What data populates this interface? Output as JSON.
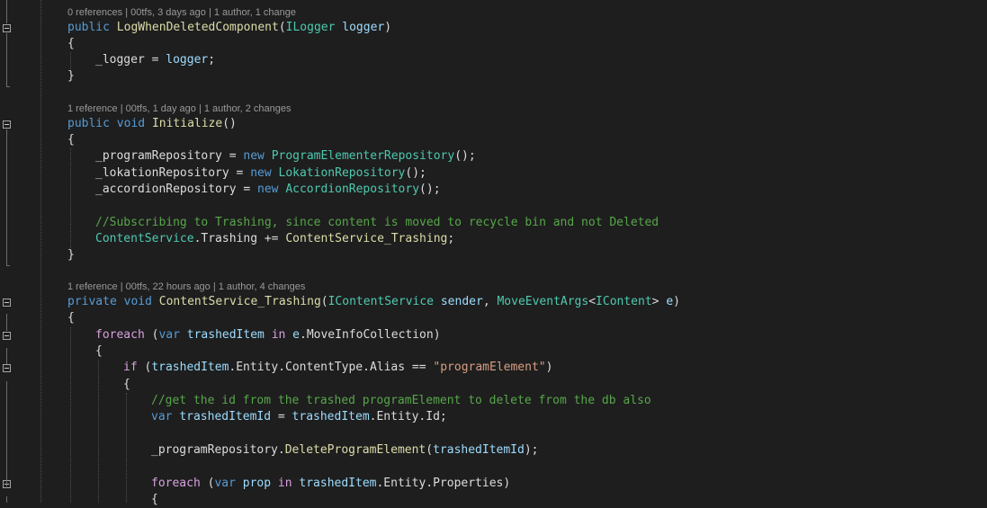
{
  "editor": {
    "theme_colors": {
      "background": "#1e1e1e",
      "keyword": "#569cd6",
      "control_keyword": "#d8a0df",
      "method": "#dcdcaa",
      "type": "#4ec9b0",
      "parameter": "#9cdcfe",
      "comment": "#57a64a",
      "string": "#d69d85",
      "plain": "#dcdcdc",
      "codelens": "#999999"
    },
    "fold_icon": "collapse-minus-icon",
    "lines": [
      {
        "kind": "lens",
        "indent": 0,
        "text": "0 references | 00tfs, 3 days ago | 1 author, 1 change"
      },
      {
        "kind": "code",
        "indent": 0,
        "fold": true,
        "tokens": [
          {
            "t": "public",
            "c": "kw"
          },
          {
            "t": " ",
            "c": "pl"
          },
          {
            "t": "LogWhenDeletedComponent",
            "c": "mth"
          },
          {
            "t": "(",
            "c": "pl"
          },
          {
            "t": "ILogger",
            "c": "typ"
          },
          {
            "t": " ",
            "c": "pl"
          },
          {
            "t": "logger",
            "c": "par"
          },
          {
            "t": ")",
            "c": "pl"
          }
        ]
      },
      {
        "kind": "code",
        "indent": 0,
        "tokens": [
          {
            "t": "{",
            "c": "pl"
          }
        ]
      },
      {
        "kind": "code",
        "indent": 1,
        "tokens": [
          {
            "t": "_logger = ",
            "c": "pl"
          },
          {
            "t": "logger",
            "c": "par"
          },
          {
            "t": ";",
            "c": "pl"
          }
        ]
      },
      {
        "kind": "code",
        "indent": 0,
        "tokens": [
          {
            "t": "}",
            "c": "pl"
          }
        ]
      },
      {
        "kind": "blank"
      },
      {
        "kind": "lens",
        "indent": 0,
        "text": "1 reference | 00tfs, 1 day ago | 1 author, 2 changes"
      },
      {
        "kind": "code",
        "indent": 0,
        "fold": true,
        "tokens": [
          {
            "t": "public",
            "c": "kw"
          },
          {
            "t": " ",
            "c": "pl"
          },
          {
            "t": "void",
            "c": "kw"
          },
          {
            "t": " ",
            "c": "pl"
          },
          {
            "t": "Initialize",
            "c": "mth"
          },
          {
            "t": "()",
            "c": "pl"
          }
        ]
      },
      {
        "kind": "code",
        "indent": 0,
        "tokens": [
          {
            "t": "{",
            "c": "pl"
          }
        ]
      },
      {
        "kind": "code",
        "indent": 1,
        "tokens": [
          {
            "t": "_programRepository = ",
            "c": "pl"
          },
          {
            "t": "new",
            "c": "kw"
          },
          {
            "t": " ",
            "c": "pl"
          },
          {
            "t": "ProgramElementerRepository",
            "c": "typ"
          },
          {
            "t": "();",
            "c": "pl"
          }
        ]
      },
      {
        "kind": "code",
        "indent": 1,
        "tokens": [
          {
            "t": "_lokationRepository = ",
            "c": "pl"
          },
          {
            "t": "new",
            "c": "kw"
          },
          {
            "t": " ",
            "c": "pl"
          },
          {
            "t": "LokationRepository",
            "c": "typ"
          },
          {
            "t": "();",
            "c": "pl"
          }
        ]
      },
      {
        "kind": "code",
        "indent": 1,
        "tokens": [
          {
            "t": "_accordionRepository = ",
            "c": "pl"
          },
          {
            "t": "new",
            "c": "kw"
          },
          {
            "t": " ",
            "c": "pl"
          },
          {
            "t": "AccordionRepository",
            "c": "typ"
          },
          {
            "t": "();",
            "c": "pl"
          }
        ]
      },
      {
        "kind": "blank"
      },
      {
        "kind": "code",
        "indent": 1,
        "tokens": [
          {
            "t": "//Subscribing to Trashing, since content is moved to recycle bin and not Deleted",
            "c": "cmt"
          }
        ]
      },
      {
        "kind": "code",
        "indent": 1,
        "tokens": [
          {
            "t": "ContentService",
            "c": "typ"
          },
          {
            "t": ".Trashing += ",
            "c": "pl"
          },
          {
            "t": "ContentService_Trashing",
            "c": "mth"
          },
          {
            "t": ";",
            "c": "pl"
          }
        ]
      },
      {
        "kind": "code",
        "indent": 0,
        "tokens": [
          {
            "t": "}",
            "c": "pl"
          }
        ]
      },
      {
        "kind": "blank"
      },
      {
        "kind": "lens",
        "indent": 0,
        "text": "1 reference | 00tfs, 22 hours ago | 1 author, 4 changes"
      },
      {
        "kind": "code",
        "indent": 0,
        "fold": true,
        "tokens": [
          {
            "t": "private",
            "c": "kw"
          },
          {
            "t": " ",
            "c": "pl"
          },
          {
            "t": "void",
            "c": "kw"
          },
          {
            "t": " ",
            "c": "pl"
          },
          {
            "t": "ContentService_Trashing",
            "c": "mth"
          },
          {
            "t": "(",
            "c": "pl"
          },
          {
            "t": "IContentService",
            "c": "typ"
          },
          {
            "t": " ",
            "c": "pl"
          },
          {
            "t": "sender",
            "c": "par"
          },
          {
            "t": ", ",
            "c": "pl"
          },
          {
            "t": "MoveEventArgs",
            "c": "typ"
          },
          {
            "t": "<",
            "c": "pl"
          },
          {
            "t": "IContent",
            "c": "typ"
          },
          {
            "t": "> ",
            "c": "pl"
          },
          {
            "t": "e",
            "c": "par"
          },
          {
            "t": ")",
            "c": "pl"
          }
        ]
      },
      {
        "kind": "code",
        "indent": 0,
        "tokens": [
          {
            "t": "{",
            "c": "pl"
          }
        ]
      },
      {
        "kind": "code",
        "indent": 1,
        "fold": true,
        "tokens": [
          {
            "t": "foreach",
            "c": "ctl"
          },
          {
            "t": " (",
            "c": "pl"
          },
          {
            "t": "var",
            "c": "kw"
          },
          {
            "t": " ",
            "c": "pl"
          },
          {
            "t": "trashedItem",
            "c": "par"
          },
          {
            "t": " ",
            "c": "pl"
          },
          {
            "t": "in",
            "c": "ctl"
          },
          {
            "t": " ",
            "c": "pl"
          },
          {
            "t": "e",
            "c": "par"
          },
          {
            "t": ".MoveInfoCollection)",
            "c": "pl"
          }
        ]
      },
      {
        "kind": "code",
        "indent": 1,
        "tokens": [
          {
            "t": "{",
            "c": "pl"
          }
        ]
      },
      {
        "kind": "code",
        "indent": 2,
        "fold": true,
        "tokens": [
          {
            "t": "if",
            "c": "ctl"
          },
          {
            "t": " (",
            "c": "pl"
          },
          {
            "t": "trashedItem",
            "c": "par"
          },
          {
            "t": ".Entity.ContentType.Alias == ",
            "c": "pl"
          },
          {
            "t": "\"programElement\"",
            "c": "str"
          },
          {
            "t": ")",
            "c": "pl"
          }
        ]
      },
      {
        "kind": "code",
        "indent": 2,
        "tokens": [
          {
            "t": "{",
            "c": "pl"
          }
        ]
      },
      {
        "kind": "code",
        "indent": 3,
        "tokens": [
          {
            "t": "//get the id from the trashed programElement to delete from the db also",
            "c": "cmt"
          }
        ]
      },
      {
        "kind": "code",
        "indent": 3,
        "tokens": [
          {
            "t": "var",
            "c": "kw"
          },
          {
            "t": " ",
            "c": "pl"
          },
          {
            "t": "trashedItemId",
            "c": "par"
          },
          {
            "t": " = ",
            "c": "pl"
          },
          {
            "t": "trashedItem",
            "c": "par"
          },
          {
            "t": ".Entity.Id;",
            "c": "pl"
          }
        ]
      },
      {
        "kind": "blank"
      },
      {
        "kind": "code",
        "indent": 3,
        "tokens": [
          {
            "t": "_programRepository.",
            "c": "pl"
          },
          {
            "t": "DeleteProgramElement",
            "c": "mth"
          },
          {
            "t": "(",
            "c": "pl"
          },
          {
            "t": "trashedItemId",
            "c": "par"
          },
          {
            "t": ");",
            "c": "pl"
          }
        ]
      },
      {
        "kind": "blank"
      },
      {
        "kind": "code",
        "indent": 3,
        "fold": true,
        "tokens": [
          {
            "t": "foreach",
            "c": "ctl"
          },
          {
            "t": " (",
            "c": "pl"
          },
          {
            "t": "var",
            "c": "kw"
          },
          {
            "t": " ",
            "c": "pl"
          },
          {
            "t": "prop",
            "c": "par"
          },
          {
            "t": " ",
            "c": "pl"
          },
          {
            "t": "in",
            "c": "ctl"
          },
          {
            "t": " ",
            "c": "pl"
          },
          {
            "t": "trashedItem",
            "c": "par"
          },
          {
            "t": ".Entity.Properties)",
            "c": "pl"
          }
        ]
      },
      {
        "kind": "code",
        "indent": 3,
        "tokens": [
          {
            "t": "{",
            "c": "pl"
          }
        ]
      }
    ]
  }
}
